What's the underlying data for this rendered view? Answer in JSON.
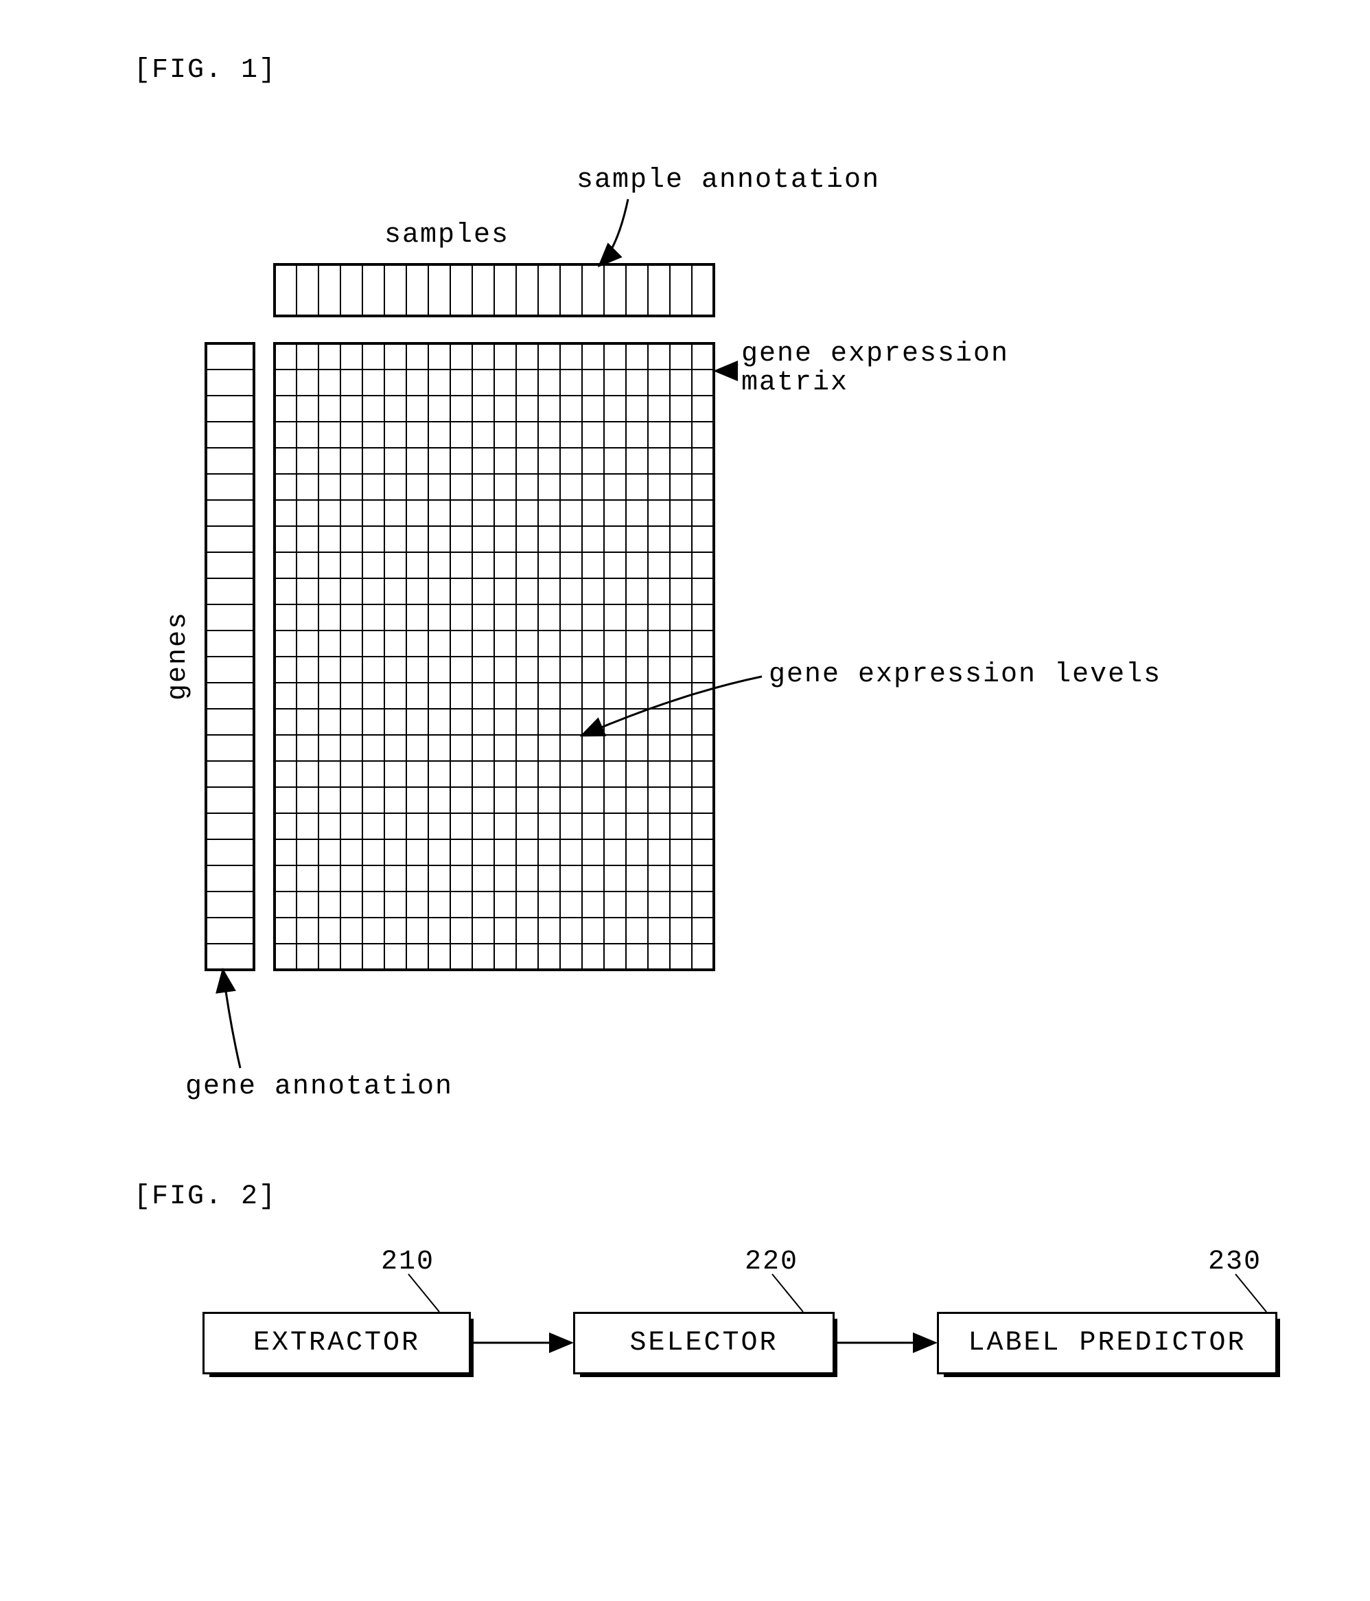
{
  "fig1": {
    "caption": "[FIG. 1]",
    "label_samples": "samples",
    "label_genes": "genes",
    "label_sample_annotation": "sample annotation",
    "label_gene_expression_matrix": "gene expression\nmatrix",
    "label_gene_expression_levels": "gene expression levels",
    "label_gene_annotation": "gene annotation",
    "grid": {
      "sample_cols": 20,
      "gene_rows": 24,
      "matrix_cols": 20,
      "matrix_rows": 24
    }
  },
  "fig2": {
    "caption": "[FIG. 2]",
    "blocks": [
      {
        "ref": "210",
        "label": "EXTRACTOR"
      },
      {
        "ref": "220",
        "label": "SELECTOR"
      },
      {
        "ref": "230",
        "label": "LABEL PREDICTOR"
      }
    ]
  }
}
